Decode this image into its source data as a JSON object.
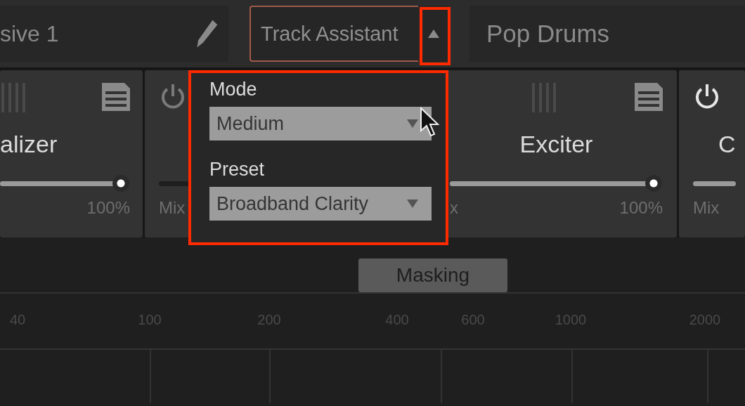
{
  "header": {
    "preset_name": "sive 1",
    "track_assistant": {
      "label": "Track Assistant",
      "expanded": true,
      "highlighted": true
    },
    "track_name": "Pop Drums"
  },
  "modules": [
    {
      "title": "alizer",
      "handle": true,
      "menu": true,
      "level": 1,
      "value": "100%"
    },
    {
      "power_on": false,
      "mix_label": "Mix"
    },
    {
      "title": "Exciter",
      "handle": true,
      "menu": true,
      "level": 1,
      "mix_label": "x",
      "value": "100%"
    },
    {
      "power_on": true,
      "title": "C",
      "mix_label": "Mix"
    }
  ],
  "popup": {
    "highlighted": true,
    "fields": [
      {
        "label": "Mode",
        "value": "Medium"
      },
      {
        "label": "Preset",
        "value": "Broadband Clarity"
      }
    ]
  },
  "masking_button": "Masking",
  "frequency_axis": [
    "40",
    "100",
    "200",
    "400",
    "600",
    "1000",
    "2000"
  ]
}
